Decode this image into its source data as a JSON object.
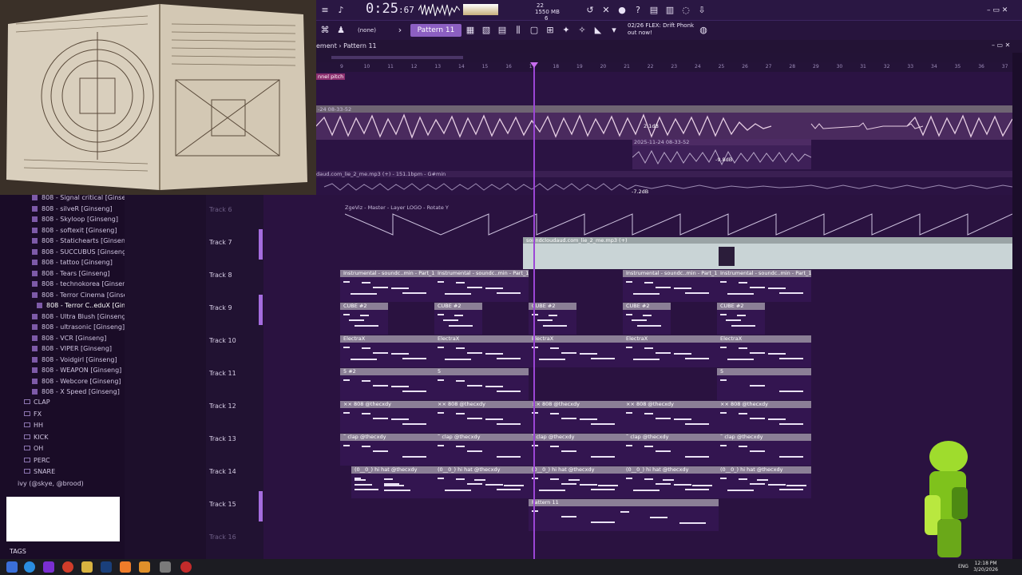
{
  "toolbar": {
    "time_main": "0:25",
    "time_frac": "67",
    "cpu_value": "22",
    "ram_value": "1550 MB",
    "ram_sub": "6",
    "none_label": "(none)",
    "pattern_label": "Pattern 11",
    "news_line1": "02/26 FLEX: Drift Phonk",
    "news_line2": "out now!"
  },
  "playlist": {
    "breadcrumb": "ement › Pattern 11",
    "ruler_ticks": [
      "9",
      "10",
      "11",
      "12",
      "13",
      "14",
      "15",
      "16",
      "17",
      "18",
      "19",
      "20",
      "21",
      "22",
      "23",
      "24",
      "25",
      "26",
      "27",
      "28",
      "29",
      "30",
      "31",
      "32",
      "33",
      "34",
      "35",
      "36",
      "37"
    ],
    "automation_label": "nnel pitch",
    "audio1_label": "-24 08-33-52",
    "audio1_db": "2.1dB",
    "audio2_label": "2025-11-24 08-33-52",
    "audio2_db": "-9.8dB",
    "audio3_label": "daud.com_lie_2_me.mp3 (+) - 151.1bpm - G#min",
    "audio3_db": "-7.2dB",
    "track6_auto": "ZgeViz - Master - Layer LOGO - Rotate Y"
  },
  "tracks": [
    {
      "label": "Track 6"
    },
    {
      "label": "Track 7"
    },
    {
      "label": "Track 8"
    },
    {
      "label": "Track 9"
    },
    {
      "label": "Track 10"
    },
    {
      "label": "Track 11"
    },
    {
      "label": "Track 12"
    },
    {
      "label": "Track 13"
    },
    {
      "label": "Track 14"
    },
    {
      "label": "Track 15"
    },
    {
      "label": "Track 16"
    }
  ],
  "clips": {
    "track7_audio": "soundcloudaud.com_lie_2_me.mp3 (+)",
    "instrumental": "Instrumental - soundc..min - Part_1 #2",
    "cube": "CUBE #2",
    "electrax": "ElectraX",
    "five2": "5 #2",
    "five": "5",
    "bass808": "×× 808 @thecxdy",
    "clap": "˜ clap @thecxdy",
    "hihat": "(0__0_) hi hat @thecxdy",
    "pattern11": "Pattern 11"
  },
  "browser": {
    "items": [
      "808 - Signal critical [Ginseng]",
      "808 - silveR [Ginseng]",
      "808 - Skyloop [Ginseng]",
      "808 - softexit [Ginseng]",
      "808 - Statichearts [Ginseng]",
      "808 - SUCCUBUS [Ginseng]",
      "808 - tattoo [Ginseng]",
      "808 - Tears [Ginseng]",
      "808 - technokorea [Ginseng]",
      "808 - Terror Cinema [Ginseng]",
      "808 - Terror C..eduX [Ginseng]",
      "808 - Ultra Blush [Ginseng]",
      "808 - ultrasonic [Ginseng]",
      "808 - VCR [Ginseng]",
      "808 - VIPER [Ginseng]",
      "808 - Voidgirl [Ginseng]",
      "808 - WEAPON [Ginseng]",
      "808 - Webcore [Ginseng]",
      "808 - X Speed [Ginseng]"
    ],
    "folders": [
      "CLAP",
      "FX",
      "HH",
      "KICK",
      "OH",
      "PERC",
      "SNARE"
    ],
    "root_folder": "ivy (@skye, @brood)",
    "tags_label": "TAGS"
  },
  "taskbar": {
    "time": "12:18 PM",
    "date": "3/20/2026",
    "lang": "ENG"
  },
  "colors": {
    "accent": "#8c5fc2",
    "playhead": "#9b46d6",
    "background": "#2a1240"
  }
}
